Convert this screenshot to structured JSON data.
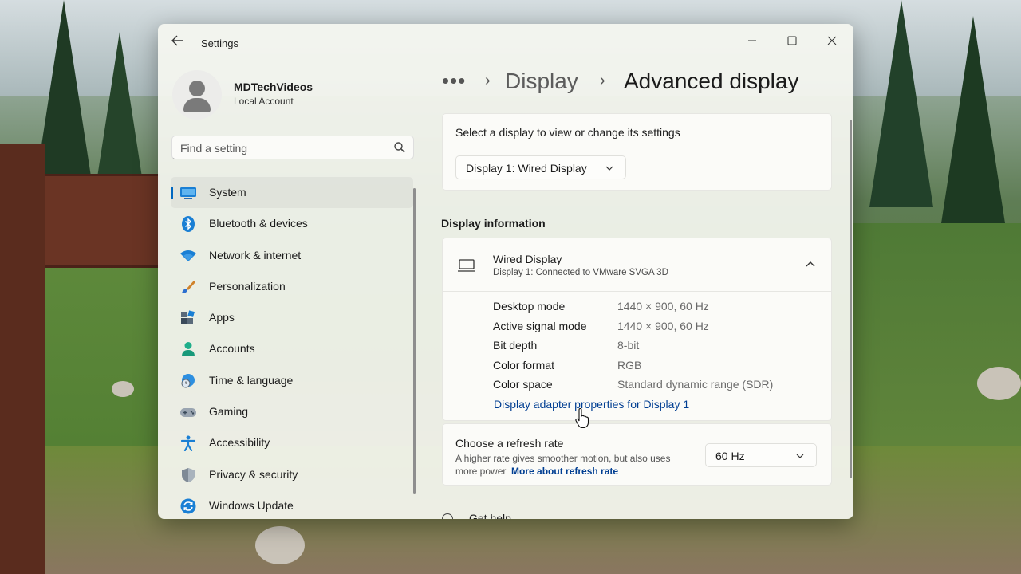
{
  "window": {
    "title": "Settings"
  },
  "account": {
    "name": "MDTechVideos",
    "type": "Local Account"
  },
  "search": {
    "placeholder": "Find a setting"
  },
  "sidebar": {
    "items": [
      {
        "label": "System",
        "icon": "system-icon",
        "active": true
      },
      {
        "label": "Bluetooth & devices",
        "icon": "bluetooth-icon"
      },
      {
        "label": "Network & internet",
        "icon": "wifi-icon"
      },
      {
        "label": "Personalization",
        "icon": "brush-icon"
      },
      {
        "label": "Apps",
        "icon": "apps-icon"
      },
      {
        "label": "Accounts",
        "icon": "accounts-icon"
      },
      {
        "label": "Time & language",
        "icon": "globe-clock-icon"
      },
      {
        "label": "Gaming",
        "icon": "gamepad-icon"
      },
      {
        "label": "Accessibility",
        "icon": "accessibility-icon"
      },
      {
        "label": "Privacy & security",
        "icon": "shield-icon"
      },
      {
        "label": "Windows Update",
        "icon": "update-icon"
      }
    ]
  },
  "breadcrumb": {
    "more": "•••",
    "sep": "›",
    "parent": "Display",
    "current": "Advanced display"
  },
  "select_display": {
    "label": "Select a display to view or change its settings",
    "value": "Display 1: Wired Display"
  },
  "display_info": {
    "section_title": "Display information",
    "title": "Wired Display",
    "subtitle": "Display 1: Connected to VMware SVGA 3D",
    "rows": [
      {
        "key": "Desktop mode",
        "value": "1440 × 900, 60 Hz"
      },
      {
        "key": "Active signal mode",
        "value": "1440 × 900, 60 Hz"
      },
      {
        "key": "Bit depth",
        "value": "8-bit"
      },
      {
        "key": "Color format",
        "value": "RGB"
      },
      {
        "key": "Color space",
        "value": "Standard dynamic range (SDR)"
      }
    ],
    "adapter_link": "Display adapter properties for Display 1"
  },
  "refresh": {
    "title": "Choose a refresh rate",
    "desc": "A higher rate gives smoother motion, but also uses more power",
    "link": "More about refresh rate",
    "value": "60 Hz"
  },
  "help": {
    "label": "Get help"
  },
  "colors": {
    "accent": "#0067c0",
    "link": "#003e92"
  }
}
